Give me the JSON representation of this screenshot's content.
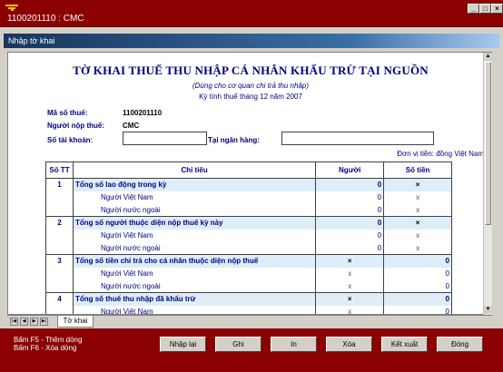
{
  "window": {
    "title": "1100201110 : CMC",
    "minimize": "_",
    "maximize": "□",
    "close": "×"
  },
  "subwindow": {
    "title": "Nhập tờ khai"
  },
  "form": {
    "title": "TỜ KHAI THUẾ THU NHẬP CÁ NHÂN KHẤU TRỪ TẠI NGUỒN",
    "subtitle": "(Dùng cho cơ quan chi trả thu nhập)",
    "period": "Kỳ tính thuế tháng 12 năm 2007",
    "tax_code_label": "Mã số thuế:",
    "tax_code_value": "1100201110",
    "payer_label": "Người nộp thuế:",
    "payer_value": "CMC",
    "account_label": "Số tài khoản:",
    "account_value": "",
    "bank_label": "Tại ngân hàng:",
    "bank_value": "",
    "unit": "Đơn vị tiền: đồng Việt Nam"
  },
  "table": {
    "headers": {
      "stt": "Số TT",
      "indicator": "Chỉ tiêu",
      "persons": "Người",
      "amount": "Số tiền"
    },
    "rows": [
      {
        "kind": "main",
        "stt": "1",
        "label": "Tổng số lao động trong kỳ",
        "persons": "0",
        "amount": "×"
      },
      {
        "kind": "sub",
        "stt": "",
        "label": "Người Việt Nam",
        "persons": "0",
        "amount": "x"
      },
      {
        "kind": "sub",
        "stt": "",
        "label": "Người nước ngoài",
        "persons": "0",
        "amount": "x"
      },
      {
        "kind": "main",
        "stt": "2",
        "label": "Tổng số người thuộc diện nộp thuế kỳ này",
        "persons": "0",
        "amount": "×"
      },
      {
        "kind": "sub",
        "stt": "",
        "label": "Người Việt Nam",
        "persons": "0",
        "amount": "x"
      },
      {
        "kind": "sub",
        "stt": "",
        "label": "Người nước ngoài",
        "persons": "0",
        "amount": "x"
      },
      {
        "kind": "main",
        "stt": "3",
        "label": "Tổng số tiền chi trả cho cá nhân thuộc diện nộp thuế",
        "persons": "×",
        "amount": "0"
      },
      {
        "kind": "sub",
        "stt": "",
        "label": "Người Việt Nam",
        "persons": "x",
        "amount": "0"
      },
      {
        "kind": "sub",
        "stt": "",
        "label": "Người nước ngoài",
        "persons": "x",
        "amount": "0"
      },
      {
        "kind": "main",
        "stt": "4",
        "label": "Tổng số thuế thu nhập đã khấu trừ",
        "persons": "×",
        "amount": "0"
      },
      {
        "kind": "sub",
        "stt": "",
        "label": "Người Việt Nam",
        "persons": "x",
        "amount": "0"
      }
    ]
  },
  "tabs": {
    "nav": [
      "|◀",
      "◀",
      "▶",
      "▶|"
    ],
    "active": "Tờ khai"
  },
  "footer": {
    "hint1": "Bấm F5 - Thêm dòng",
    "hint2": "Bấm F6 - Xóa dòng",
    "buttons": {
      "reset": "Nhập lại",
      "save": "Ghi",
      "print": "In",
      "delete": "Xóa",
      "export": "Kết xuất",
      "close": "Đóng"
    }
  },
  "colors": {
    "title_bar": "#8b0000",
    "header_text": "#000080",
    "row_highlight": "#ddeef9"
  }
}
